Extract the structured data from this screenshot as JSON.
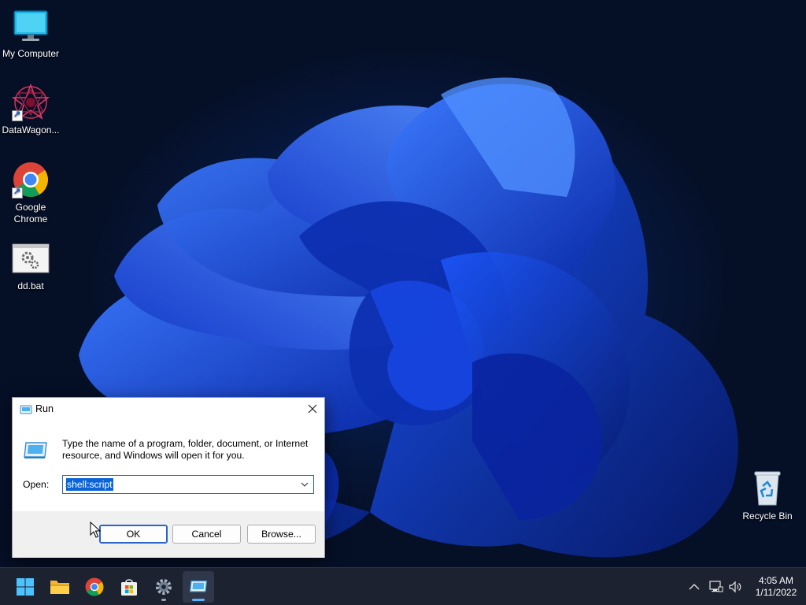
{
  "desktop": {
    "icons": [
      {
        "label": "My Computer"
      },
      {
        "label": "DataWagon..."
      },
      {
        "label": "Google Chrome"
      },
      {
        "label": "dd.bat"
      },
      {
        "label": "Recycle Bin"
      }
    ]
  },
  "run_dialog": {
    "title": "Run",
    "description": "Type the name of a program, folder, document, or Internet resource, and Windows will open it for you.",
    "open_label": "Open:",
    "input_value": "shell:script",
    "buttons": {
      "ok": "OK",
      "cancel": "Cancel",
      "browse": "Browse..."
    }
  },
  "taskbar": {
    "apps": [
      "start-icon",
      "file-explorer-icon",
      "chrome-icon",
      "microsoft-store-icon",
      "settings-icon",
      "run-app-icon"
    ],
    "tray": {
      "time": "4:05 AM",
      "date": "1/11/2022"
    }
  },
  "colors": {
    "accent": "#0a64d8",
    "taskbar": "#1c2230",
    "wallpaper": "#050f26"
  }
}
